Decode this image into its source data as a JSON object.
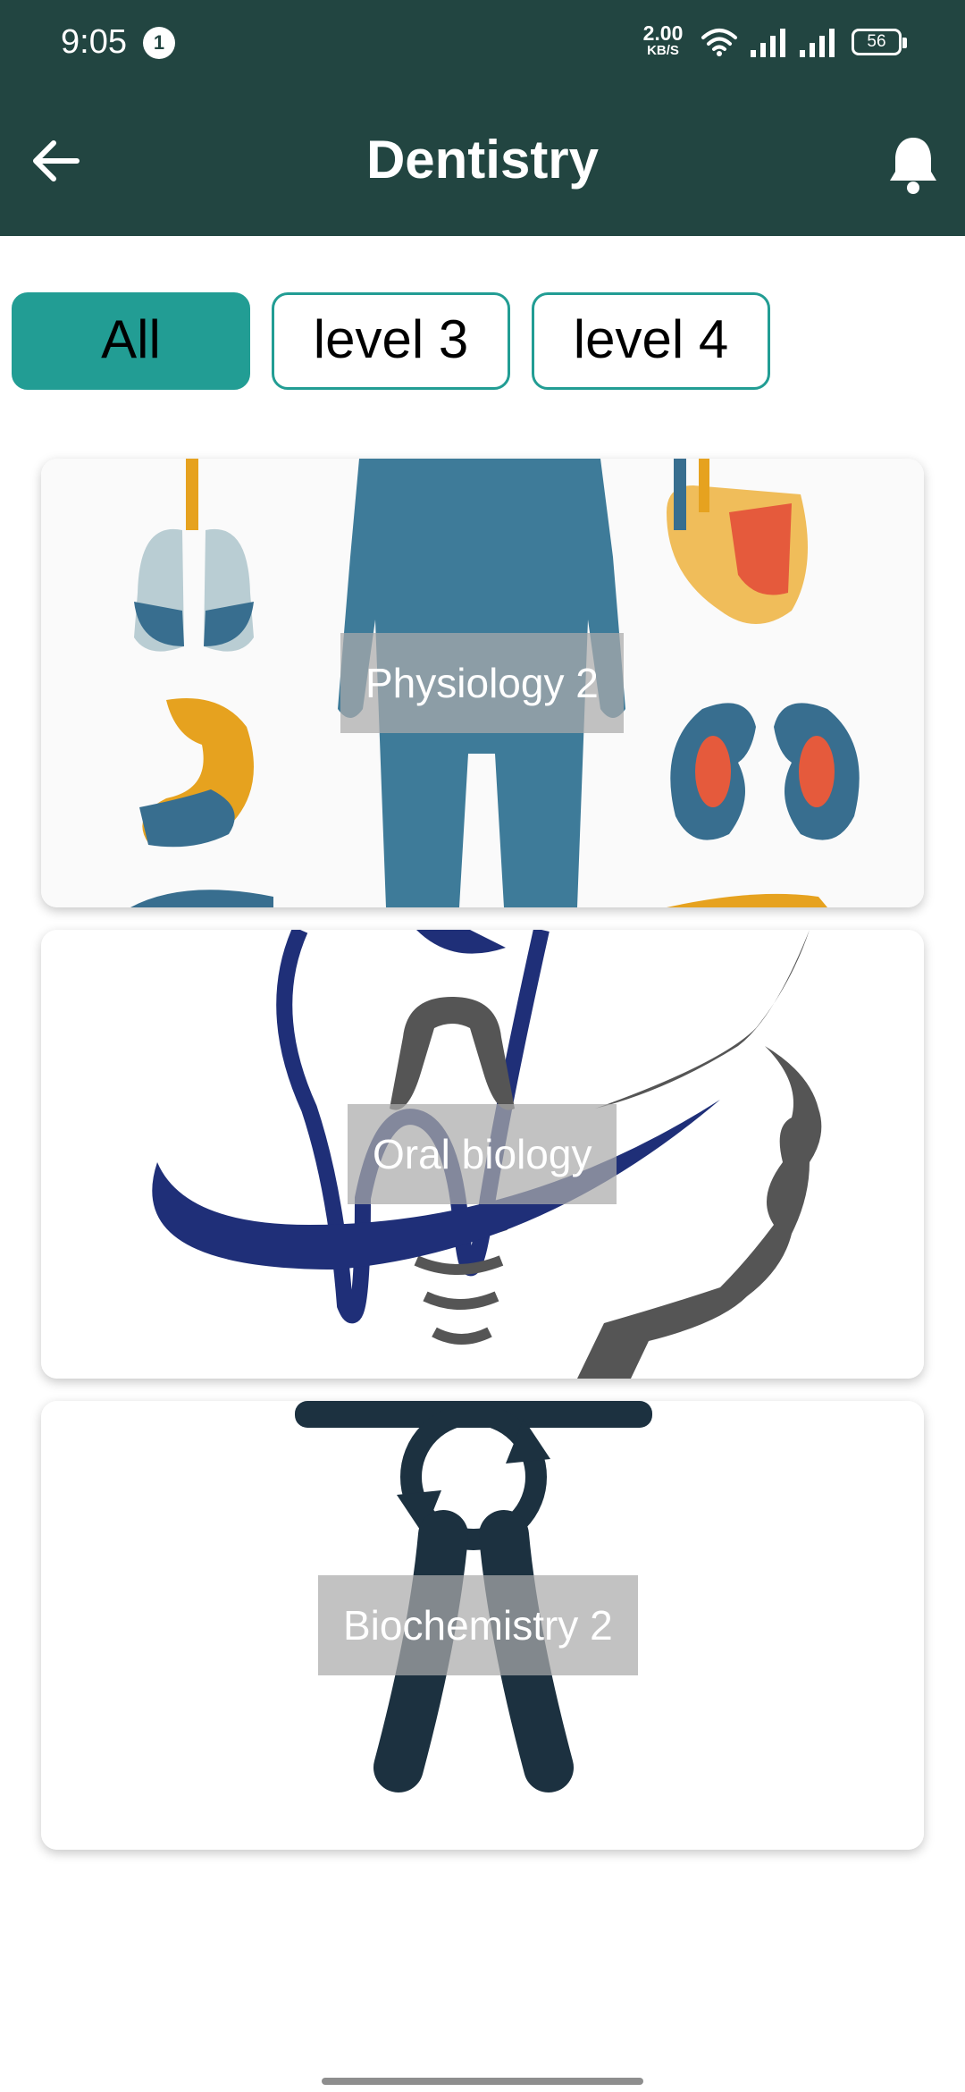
{
  "status_bar": {
    "time": "9:05",
    "notification_count": "1",
    "net_speed_value": "2.00",
    "net_speed_unit": "KB/S",
    "battery": "56"
  },
  "header": {
    "title": "Dentistry",
    "back_icon": "arrow-left-icon",
    "notification_icon": "bell-icon"
  },
  "filters": {
    "items": [
      {
        "label": "All",
        "selected": true
      },
      {
        "label": "level 3",
        "selected": false
      },
      {
        "label": "level 4",
        "selected": false
      }
    ]
  },
  "courses": [
    {
      "title": "Physiology 2",
      "image": "human-anatomy-organs"
    },
    {
      "title": "Oral biology",
      "image": "tooth-implant-face-logo"
    },
    {
      "title": "Biochemistry 2",
      "image": "dental-forceps-icon"
    }
  ],
  "colors": {
    "header_bg": "#224541",
    "accent": "#229d94"
  }
}
